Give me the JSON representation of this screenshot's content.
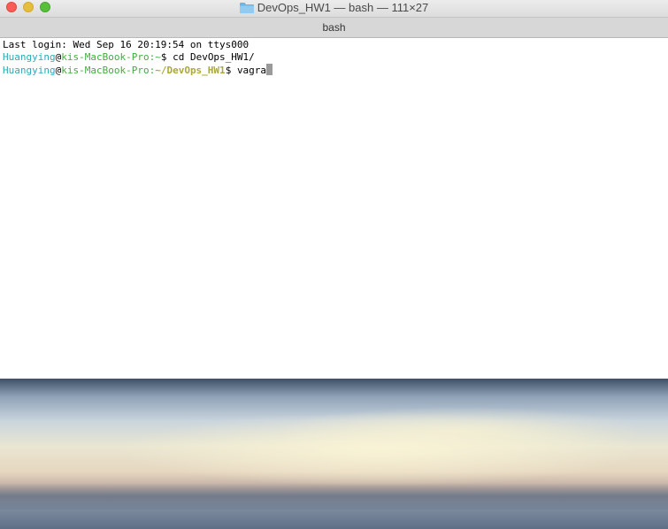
{
  "window": {
    "title": "DevOps_HW1 — bash — 111×27",
    "tab_label": "bash",
    "traffic_lights": [
      "close",
      "minimize",
      "zoom"
    ],
    "folder_icon": "folder-icon"
  },
  "terminal": {
    "last_login": "Last login: Wed Sep 16 20:19:54 on ttys000",
    "lines": [
      {
        "user": "Huangying",
        "at": "@",
        "host": "kis-MacBook-Pro",
        "sep": ":",
        "cwd": "~",
        "prompt": "$ ",
        "command": "cd DevOps_HW1/"
      },
      {
        "user": "Huangying",
        "at": "@",
        "host": "kis-MacBook-Pro",
        "sep": ":",
        "cwd": "~/DevOps_HW1",
        "prompt": "$ ",
        "command": "vagra"
      }
    ]
  },
  "colors": {
    "user": "#2fa9b8",
    "host": "#3fae3f",
    "cwd": "#aaa93a",
    "cursor": "#9a9a9a"
  }
}
